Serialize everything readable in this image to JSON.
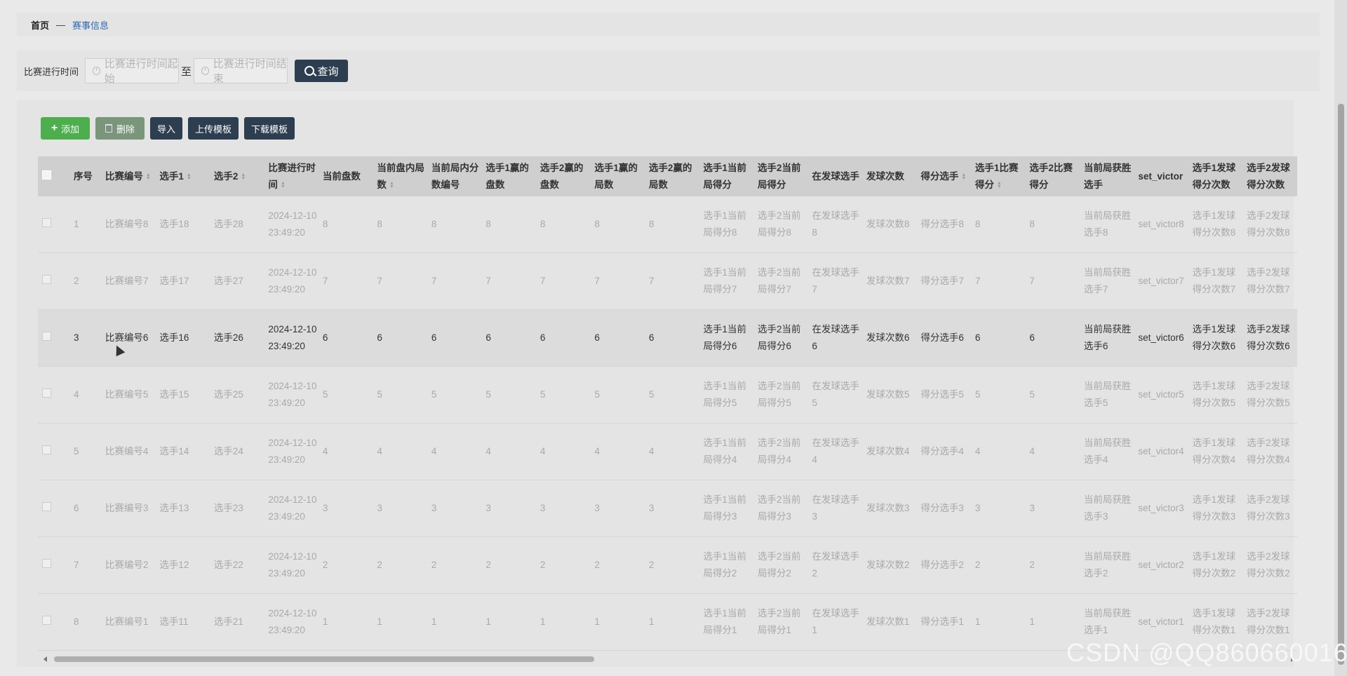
{
  "breadcrumb": {
    "home": "首页",
    "separator": "—",
    "current": "赛事信息"
  },
  "filter": {
    "label": "比赛进行时间",
    "start_placeholder": "比赛进行时间起始",
    "to": "至",
    "end_placeholder": "比赛进行时间结束",
    "query": "查询"
  },
  "toolbar": {
    "add": "添加",
    "delete": "删除",
    "import": "导入",
    "upload_template": "上传模板",
    "download_template": "下载模板"
  },
  "table": {
    "columns": [
      "序号",
      "比赛编号",
      "选手1",
      "选手2",
      "比赛进行时间",
      "当前盘数",
      "当前盘内局数",
      "当前局内分数编号",
      "选手1赢的盘数",
      "选手2赢的盘数",
      "选手1赢的局数",
      "选手2赢的局数",
      "选手1当前局得分",
      "选手2当前局得分",
      "在发球选手",
      "发球次数",
      "得分选手",
      "选手1比赛得分",
      "选手2比赛得分",
      "当前局获胜选手",
      "set_victor",
      "选手1发球得分次数",
      "选手2发球得分次数"
    ],
    "rows": [
      [
        "1",
        "比赛编号8",
        "选手18",
        "选手28",
        "2024-12-10 23:49:20",
        "8",
        "8",
        "8",
        "8",
        "8",
        "8",
        "8",
        "选手1当前局得分8",
        "选手2当前局得分8",
        "在发球选手8",
        "发球次数8",
        "得分选手8",
        "8",
        "8",
        "当前局获胜选手8",
        "set_victor8",
        "选手1发球得分次数8",
        "选手2发球得分次数8"
      ],
      [
        "2",
        "比赛编号7",
        "选手17",
        "选手27",
        "2024-12-10 23:49:20",
        "7",
        "7",
        "7",
        "7",
        "7",
        "7",
        "7",
        "选手1当前局得分7",
        "选手2当前局得分7",
        "在发球选手7",
        "发球次数7",
        "得分选手7",
        "7",
        "7",
        "当前局获胜选手7",
        "set_victor7",
        "选手1发球得分次数7",
        "选手2发球得分次数7"
      ],
      [
        "3",
        "比赛编号6",
        "选手16",
        "选手26",
        "2024-12-10 23:49:20",
        "6",
        "6",
        "6",
        "6",
        "6",
        "6",
        "6",
        "选手1当前局得分6",
        "选手2当前局得分6",
        "在发球选手6",
        "发球次数6",
        "得分选手6",
        "6",
        "6",
        "当前局获胜选手6",
        "set_victor6",
        "选手1发球得分次数6",
        "选手2发球得分次数6"
      ],
      [
        "4",
        "比赛编号5",
        "选手15",
        "选手25",
        "2024-12-10 23:49:20",
        "5",
        "5",
        "5",
        "5",
        "5",
        "5",
        "5",
        "选手1当前局得分5",
        "选手2当前局得分5",
        "在发球选手5",
        "发球次数5",
        "得分选手5",
        "5",
        "5",
        "当前局获胜选手5",
        "set_victor5",
        "选手1发球得分次数5",
        "选手2发球得分次数5"
      ],
      [
        "5",
        "比赛编号4",
        "选手14",
        "选手24",
        "2024-12-10 23:49:20",
        "4",
        "4",
        "4",
        "4",
        "4",
        "4",
        "4",
        "选手1当前局得分4",
        "选手2当前局得分4",
        "在发球选手4",
        "发球次数4",
        "得分选手4",
        "4",
        "4",
        "当前局获胜选手4",
        "set_victor4",
        "选手1发球得分次数4",
        "选手2发球得分次数4"
      ],
      [
        "6",
        "比赛编号3",
        "选手13",
        "选手23",
        "2024-12-10 23:49:20",
        "3",
        "3",
        "3",
        "3",
        "3",
        "3",
        "3",
        "选手1当前局得分3",
        "选手2当前局得分3",
        "在发球选手3",
        "发球次数3",
        "得分选手3",
        "3",
        "3",
        "当前局获胜选手3",
        "set_victor3",
        "选手1发球得分次数3",
        "选手2发球得分次数3"
      ],
      [
        "7",
        "比赛编号2",
        "选手12",
        "选手22",
        "2024-12-10 23:49:20",
        "2",
        "2",
        "2",
        "2",
        "2",
        "2",
        "2",
        "选手1当前局得分2",
        "选手2当前局得分2",
        "在发球选手2",
        "发球次数2",
        "得分选手2",
        "2",
        "2",
        "当前局获胜选手2",
        "set_victor2",
        "选手1发球得分次数2",
        "选手2发球得分次数2"
      ],
      [
        "8",
        "比赛编号1",
        "选手11",
        "选手21",
        "2024-12-10 23:49:20",
        "1",
        "1",
        "1",
        "1",
        "1",
        "1",
        "1",
        "选手1当前局得分1",
        "选手2当前局得分1",
        "在发球选手1",
        "发球次数1",
        "得分选手1",
        "1",
        "1",
        "当前局获胜选手1",
        "set_victor1",
        "选手1发球得分次数1",
        "选手2发球得分次数1"
      ]
    ],
    "highlighted_row": 3
  },
  "watermark": "CSDN @QQ860660016"
}
